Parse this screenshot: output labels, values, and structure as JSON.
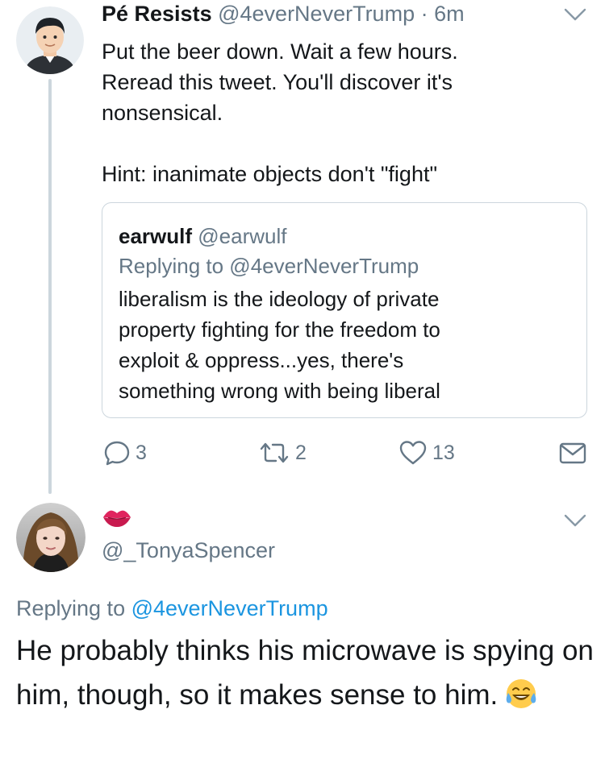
{
  "tweet": {
    "author_name": "Pé Resists",
    "handle": "@4everNeverTrump",
    "separator": "·",
    "time": "6m",
    "lines": [
      "Put the beer down. Wait a few hours.",
      "Reread this tweet. You'll discover it's",
      "nonsensical."
    ],
    "hint": "Hint: inanimate objects don't \"fight\"",
    "quoted": {
      "author_name": "earwulf",
      "handle": "@earwulf",
      "replying_to": "Replying to @4everNeverTrump",
      "lines": [
        "liberalism is the ideology of private",
        "property fighting for the freedom to",
        "exploit & oppress...yes, there's",
        "something wrong with being liberal"
      ]
    },
    "actions": {
      "reply_count": "3",
      "retweet_count": "2",
      "like_count": "13"
    }
  },
  "reply": {
    "handle": "@_TonyaSpencer",
    "replying_prefix": "Replying to",
    "replying_handle": "@4everNeverTrump",
    "text": "He probably thinks his microwave is spying on him, though, so it makes sense to him."
  },
  "colors": {
    "link": "#1b95e0",
    "muted": "#657786",
    "border": "#ccd6dd",
    "text": "#14171a"
  },
  "icons": {
    "reply": "reply-icon",
    "retweet": "retweet-icon",
    "like": "heart-icon",
    "dm": "envelope-icon",
    "more": "chevron-down-icon",
    "display_name_emoji": "kiss-lips-emoji",
    "laugh_emoji": "tears-of-joy-emoji"
  }
}
